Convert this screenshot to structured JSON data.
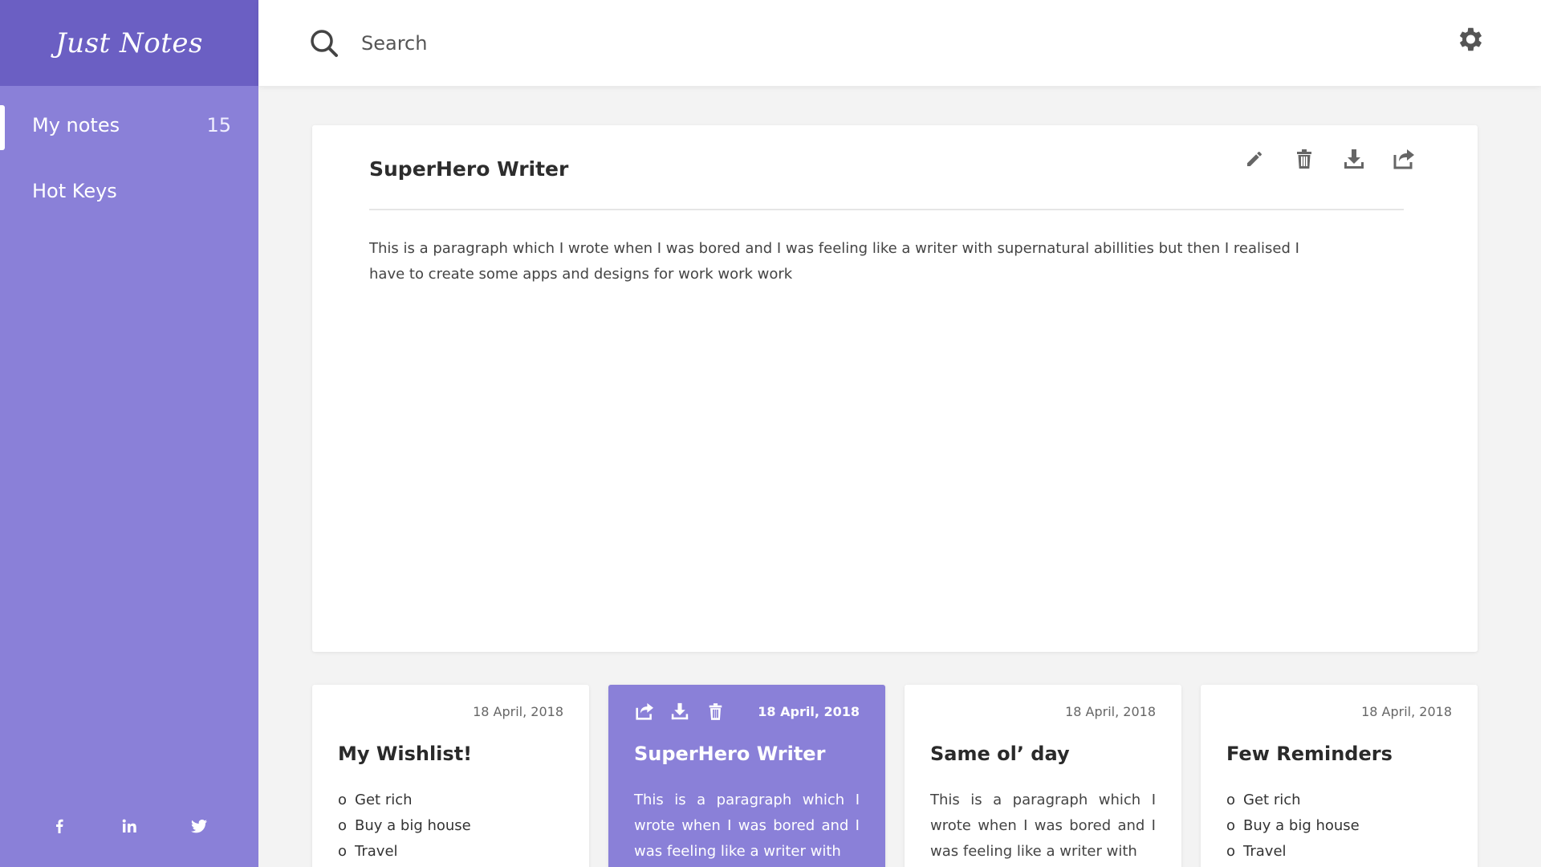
{
  "app": {
    "logo": "Just Notes"
  },
  "sidebar": {
    "items": [
      {
        "label": "My notes",
        "count": "15"
      },
      {
        "label": "Hot Keys",
        "count": ""
      }
    ],
    "social": [
      "facebook-icon",
      "linkedin-icon",
      "twitter-icon"
    ]
  },
  "header": {
    "search_placeholder": "Search"
  },
  "main_note": {
    "title": "SuperHero Writer",
    "body": "This is a paragraph which I wrote when I was bored and I was feeling like a writer with supernatural abillities  but then I realised I have to create some apps and designs for work work work"
  },
  "cards": [
    {
      "date": "18 April, 2018",
      "title": "My Wishlist!",
      "list": [
        "Get rich",
        "Buy a big house",
        "Travel"
      ]
    },
    {
      "date": "18 April, 2018",
      "title": "SuperHero Writer",
      "text": "This is a paragraph which I wrote when I was bored and I was feeling like a writer with"
    },
    {
      "date": "18 April, 2018",
      "title": "Same ol’ day",
      "text": "This is a paragraph which I wrote when I was bored and I was feeling like a writer with"
    },
    {
      "date": "18 April, 2018",
      "title": "Few Reminders",
      "list": [
        "Get rich",
        "Buy a big house",
        "Travel"
      ]
    }
  ],
  "colors": {
    "sidebar": "#8a80d8",
    "logo_bar": "#6b5fc3",
    "accent": "#8a80d8"
  }
}
